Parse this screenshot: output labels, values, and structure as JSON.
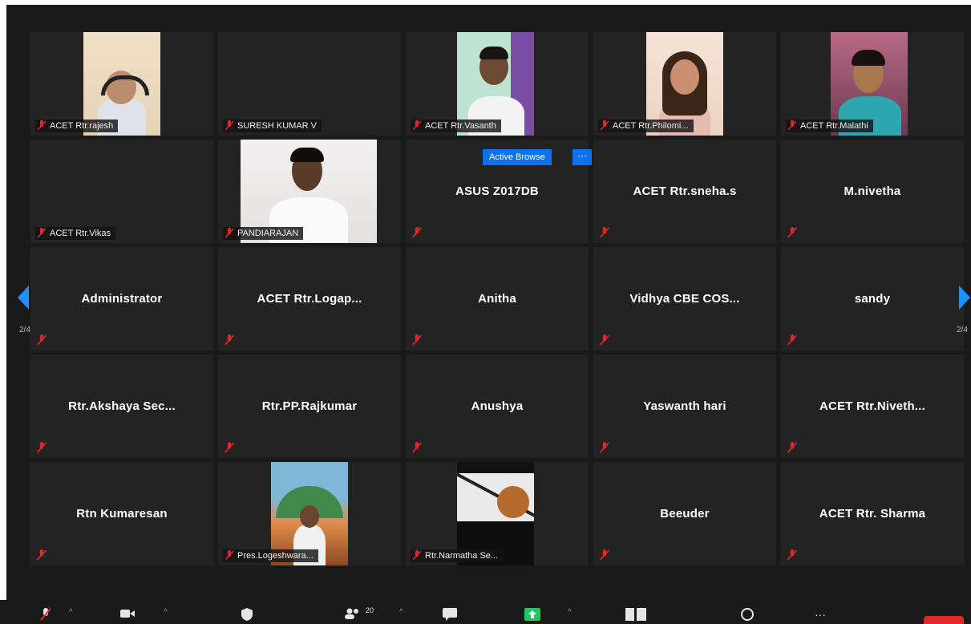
{
  "pagination": {
    "left_page": "2/4",
    "right_page": "2/4"
  },
  "active_speaker": {
    "label": "Active Browse",
    "more_label": "···"
  },
  "tiles": [
    {
      "name": "ACET Rtr.rajesh",
      "muted": true,
      "video": true
    },
    {
      "name": "SURESH KUMAR V",
      "muted": true,
      "video": false
    },
    {
      "name": "ACET Rtr.Vasanth",
      "muted": true,
      "video": true
    },
    {
      "name": "ACET Rtr.Philomi...",
      "muted": true,
      "video": true
    },
    {
      "name": "ACET Rtr.Malathi",
      "muted": true,
      "video": true
    },
    {
      "name": "ACET Rtr.Vikas",
      "muted": true,
      "video": false
    },
    {
      "name": "PANDIARAJAN",
      "muted": true,
      "video": true
    },
    {
      "name": "ASUS Z017DB",
      "muted": true,
      "video": false
    },
    {
      "name": "ACET Rtr.sneha.s",
      "muted": true,
      "video": false
    },
    {
      "name": "M.nivetha",
      "muted": true,
      "video": false
    },
    {
      "name": "Administrator",
      "muted": true,
      "video": false
    },
    {
      "name": "ACET Rtr.Logap...",
      "muted": true,
      "video": false
    },
    {
      "name": "Anitha",
      "muted": true,
      "video": false
    },
    {
      "name": "Vidhya CBE COS...",
      "muted": true,
      "video": false
    },
    {
      "name": "sandy",
      "muted": true,
      "video": false
    },
    {
      "name": "Rtr.Akshaya Sec...",
      "muted": true,
      "video": false
    },
    {
      "name": "Rtr.PP.Rajkumar",
      "muted": true,
      "video": false
    },
    {
      "name": "Anushya",
      "muted": true,
      "video": false
    },
    {
      "name": "Yaswanth hari",
      "muted": true,
      "video": false
    },
    {
      "name": "ACET Rtr.Niveth...",
      "muted": true,
      "video": false
    },
    {
      "name": "Rtn Kumaresan",
      "muted": true,
      "video": false
    },
    {
      "name": "Pres.Logeshwara...",
      "muted": true,
      "video": true
    },
    {
      "name": "Rtr.Narmatha Se...",
      "muted": true,
      "video": true
    },
    {
      "name": "Beeuder",
      "muted": true,
      "video": false
    },
    {
      "name": "ACET Rtr. Sharma",
      "muted": true,
      "video": false
    }
  ],
  "toolbar": {
    "participants_count": "20",
    "more_label": "···",
    "icons": [
      "mic-muted-icon",
      "video-icon",
      "security-icon",
      "participants-icon",
      "chat-icon",
      "share-screen-icon",
      "gallery-view-icon",
      "reactions-icon",
      "more-icon",
      "end-button"
    ]
  },
  "colors": {
    "accent": "#0e72ed",
    "muted_red": "#e02828",
    "tile_bg": "#232323",
    "stage_bg": "#1a1a1a"
  }
}
